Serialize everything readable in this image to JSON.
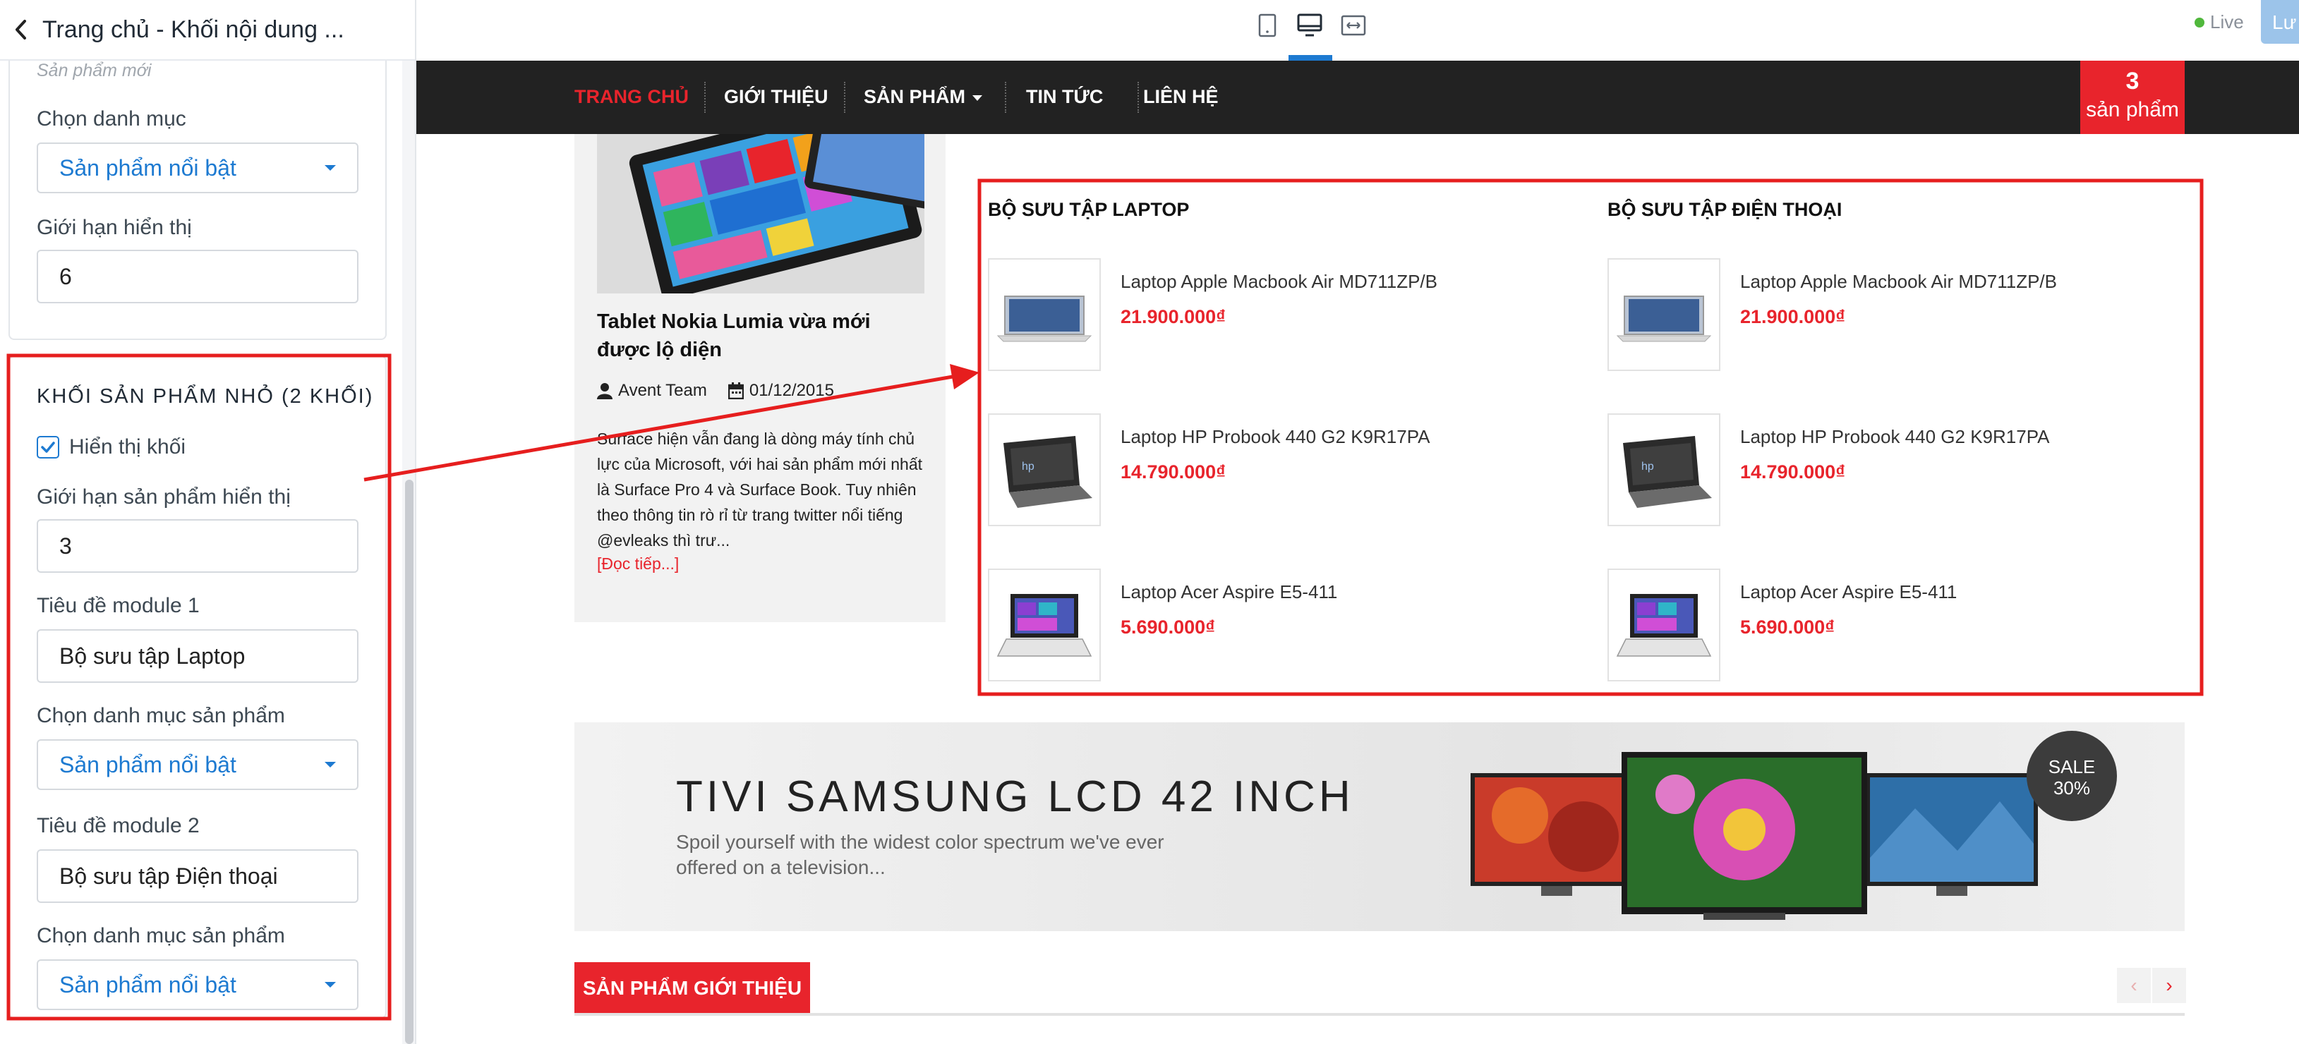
{
  "sidebar": {
    "title": "Trang chủ - Khối nội dung ...",
    "top_panel": {
      "faded_label": "Sản phẩm mới",
      "category_label": "Chọn danh mục",
      "category_value": "Sản phẩm nổi bật",
      "limit_label": "Giới hạn hiển thị",
      "limit_value": "6"
    },
    "small_block_panel": {
      "title": "KHỐI SẢN PHẨM NHỎ (2 KHỐI)",
      "show_block_label": "Hiển thị khối",
      "show_block_checked": true,
      "product_limit_label": "Giới hạn sản phẩm hiển thị",
      "product_limit_value": "3",
      "module1_title_label": "Tiêu đề module 1",
      "module1_title_value": "Bộ sưu tập Laptop",
      "module1_category_label": "Chọn danh mục sản phẩm",
      "module1_category_value": "Sản phẩm nổi bật",
      "module2_title_label": "Tiêu đề module 2",
      "module2_title_value": "Bộ sưu tập Điện thoại",
      "module2_category_label": "Chọn danh mục sản phẩm",
      "module2_category_value": "Sản phẩm nổi bật"
    }
  },
  "toolbar": {
    "devices": [
      "mobile-icon",
      "desktop-icon",
      "fullwidth-icon"
    ],
    "active_device": "desktop",
    "live_label": "Live",
    "save_label": "Lư"
  },
  "site": {
    "nav": {
      "items": [
        "TRANG CHỦ",
        "GIỚI THIỆU",
        "SẢN PHẨM",
        "TIN TỨC",
        "LIÊN HỆ"
      ],
      "active": "TRANG CHỦ",
      "cart_count": "3",
      "cart_label": "sản phẩm"
    },
    "blog": {
      "title": "Tablet Nokia Lumia vừa mới được lộ diện",
      "author": "Avent Team",
      "date": "01/12/2015",
      "excerpt": "Surface hiện vẫn đang là dòng máy tính chủ lực của Microsoft, với hai sản phẩm mới nhất là Surface Pro 4 và Surface Book. Tuy nhiên theo thông tin rò rỉ từ trang twitter nổi tiếng @evleaks thì trư...",
      "read_more": "[Đọc tiếp...]"
    },
    "collections": [
      {
        "title": "BỘ SƯU TẬP LAPTOP",
        "products": [
          {
            "name": "Laptop Apple Macbook Air MD711ZP/B",
            "price": "21.900.000₫"
          },
          {
            "name": "Laptop HP Probook 440 G2 K9R17PA",
            "price": "14.790.000₫"
          },
          {
            "name": "Laptop Acer Aspire E5-411",
            "price": "5.690.000₫"
          }
        ]
      },
      {
        "title": "BỘ SƯU TẬP ĐIỆN THOẠI",
        "products": [
          {
            "name": "Laptop Apple Macbook Air MD711ZP/B",
            "price": "21.900.000₫"
          },
          {
            "name": "Laptop HP Probook 440 G2 K9R17PA",
            "price": "14.790.000₫"
          },
          {
            "name": "Laptop Acer Aspire E5-411",
            "price": "5.690.000₫"
          }
        ]
      }
    ],
    "banner": {
      "title": "TIVI SAMSUNG LCD 42 INCH",
      "subtitle": "Spoil yourself with the widest color spectrum we've ever offered on a television...",
      "sale_line1": "SALE",
      "sale_line2": "30%"
    },
    "featured": {
      "tab_label": "SẢN PHẨM GIỚI THIỆU",
      "prev_symbol": "‹",
      "next_symbol": "›"
    }
  },
  "colors": {
    "accent_red": "#e8242c",
    "nav_bg": "#222222",
    "link_blue": "#1d7ad1",
    "annotation_red": "#e61e1e"
  }
}
